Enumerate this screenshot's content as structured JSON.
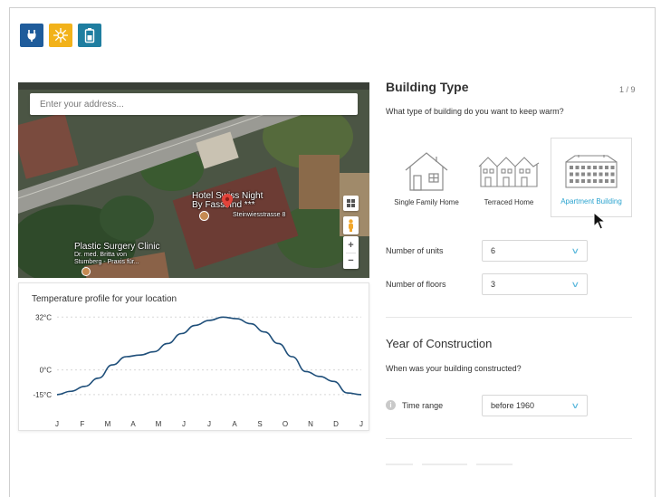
{
  "top_icons": [
    {
      "icon": "power-plug-icon",
      "color": "#1f5c9b"
    },
    {
      "icon": "sun-icon",
      "color": "#f2b21a"
    },
    {
      "icon": "battery-icon",
      "color": "#1f7ea0"
    }
  ],
  "map": {
    "address_placeholder": "Enter your address...",
    "labels": {
      "hotel_line1": "Hotel Swiss Night",
      "hotel_line2": "By Fassbind ***",
      "street": "Steinwiesstrasse 8",
      "clinic_line1": "Plastic Surgery Clinic",
      "clinic_line2": "Dr. med. Britta von",
      "clinic_line3": "Stumberg - Praxis für..."
    },
    "zoom_in": "+",
    "zoom_out": "−"
  },
  "chart_data": {
    "type": "line",
    "title": "Temperature profile for your location",
    "categories": [
      "J",
      "F",
      "M",
      "A",
      "M",
      "J",
      "J",
      "A",
      "S",
      "O",
      "N",
      "D",
      "J"
    ],
    "x": [
      0,
      0.5,
      1,
      1.5,
      2,
      2.5,
      3,
      3.5,
      4,
      4.5,
      5,
      5.5,
      6,
      6.5,
      7,
      7.5,
      8,
      8.5,
      9,
      9.5,
      10,
      10.5,
      11,
      11.5,
      12,
      12.5
    ],
    "values": [
      -15,
      -13,
      -10,
      -5,
      3,
      8,
      9,
      11,
      16,
      22,
      27,
      30,
      32,
      31,
      28,
      23,
      16,
      8,
      -1,
      -4,
      -7,
      -14,
      -15
    ],
    "ylabel_ticks": [
      "32°C",
      "0°C",
      "-15°C"
    ],
    "y_ticks": [
      32,
      0,
      -15
    ],
    "ylim": [
      -20,
      36
    ],
    "grid": true
  },
  "panel": {
    "title": "Building Type",
    "step": "1 / 9",
    "question": "What type of building do you want to keep warm?",
    "building_types": [
      {
        "label": "Single Family Home",
        "icon": "single-family-home-icon",
        "selected": false
      },
      {
        "label": "Terraced Home",
        "icon": "terraced-home-icon",
        "selected": false
      },
      {
        "label": "Apartment Building",
        "icon": "apartment-building-icon",
        "selected": true
      }
    ],
    "units_label": "Number of units",
    "units_value": "6",
    "floors_label": "Number of floors",
    "floors_value": "3",
    "construction_title": "Year of Construction",
    "construction_question": "When was your building constructed?",
    "time_range_label": "Time range",
    "time_range_value": "before 1960"
  },
  "colors": {
    "accent": "#2aa3cf",
    "chart_line": "#1f4f7a"
  }
}
